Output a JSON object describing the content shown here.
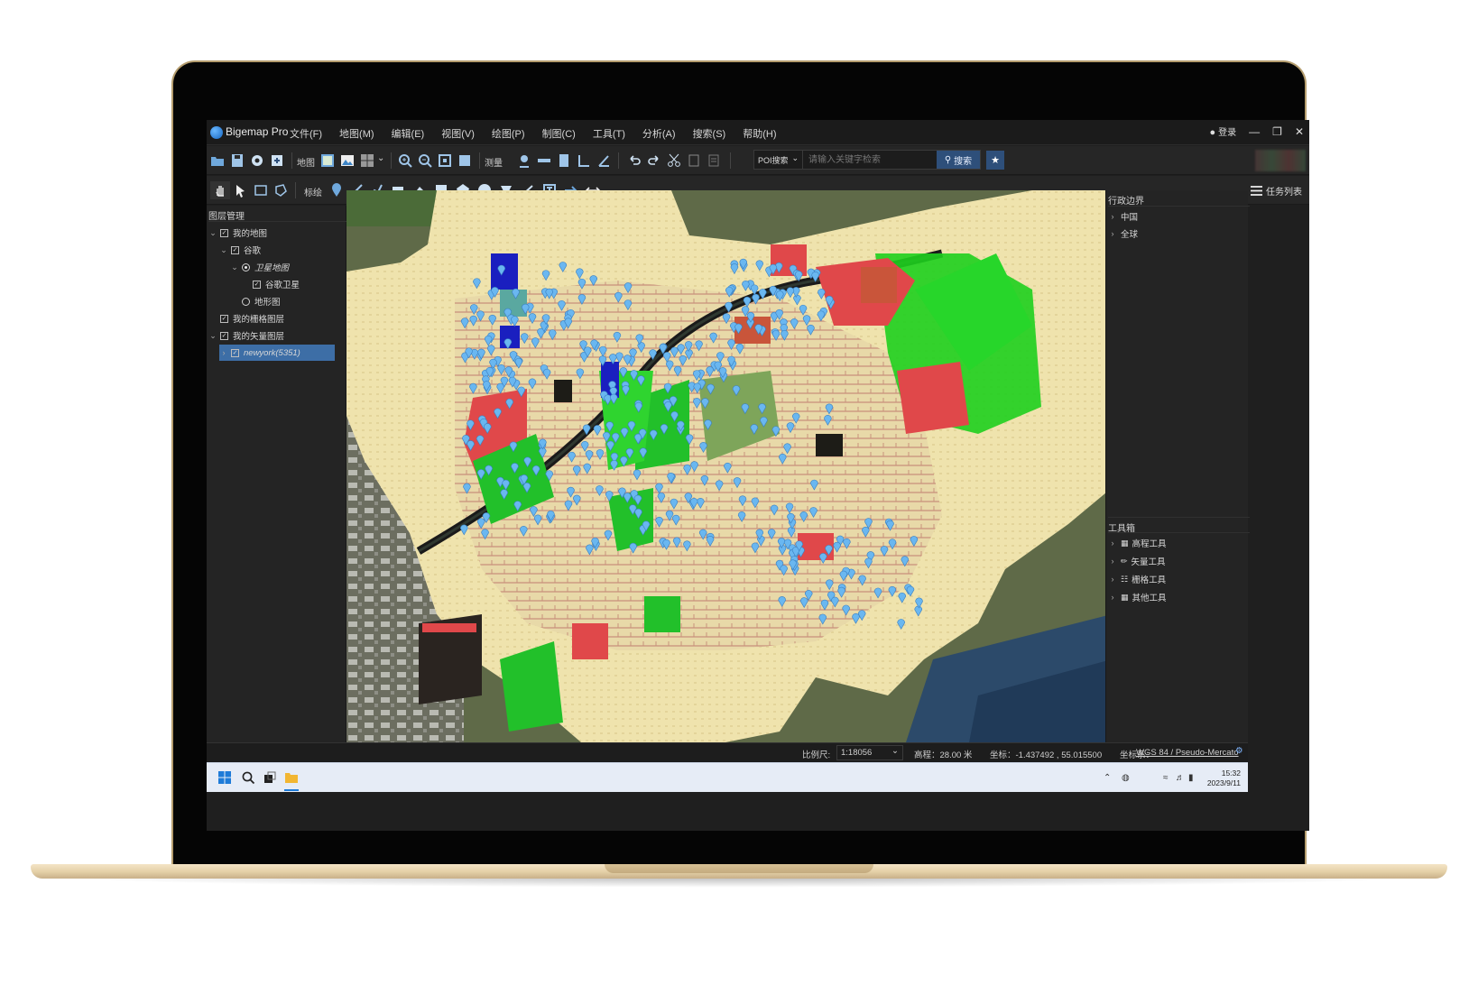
{
  "app": {
    "name": "Bigemap Pro",
    "menus": [
      "文件(F)",
      "地图(M)",
      "编辑(E)",
      "视图(V)",
      "绘图(P)",
      "制图(C)",
      "工具(T)",
      "分析(A)",
      "搜索(S)",
      "帮助(H)"
    ],
    "login": "登录"
  },
  "toolbar1": {
    "map_label": "地图",
    "measure_label": "测量",
    "poi_select": "POI搜索",
    "search_placeholder": "请输入关键字检索",
    "search_button": "搜索"
  },
  "toolbar2": {
    "mark_label": "标绘",
    "task_list": "任务列表"
  },
  "layers_panel": {
    "title": "图层管理",
    "items": [
      {
        "label": "我的地图"
      },
      {
        "label": "谷歌"
      },
      {
        "label": "卫星地图"
      },
      {
        "label": "谷歌卫星"
      },
      {
        "label": "地形图"
      },
      {
        "label": "我的栅格图层"
      },
      {
        "label": "我的矢量图层"
      },
      {
        "label": "newyork(5351)"
      }
    ]
  },
  "admin_panel": {
    "title": "行政边界",
    "items": [
      "中国",
      "全球"
    ]
  },
  "toolbox": {
    "title": "工具箱",
    "items": [
      "高程工具",
      "矢量工具",
      "栅格工具",
      "其他工具"
    ]
  },
  "status": {
    "scale_label": "比例尺:",
    "scale_value": "1:18056",
    "elevation": "高程：28.00 米",
    "coords": "坐标：-1.437492 , 55.015500",
    "crs_label": "坐标系：",
    "crs_value": "WGS 84 / Pseudo-Mercato"
  },
  "taskbar": {
    "time": "15:32",
    "date": "2023/9/11"
  },
  "colors": {
    "accent": "#2e4f7a",
    "selection": "#3d6ea6",
    "poi_marker": "#6ab7f0",
    "park_green": "#1ecf1e",
    "building_red": "#e0484a",
    "residential_beige": "#efe3ad"
  }
}
